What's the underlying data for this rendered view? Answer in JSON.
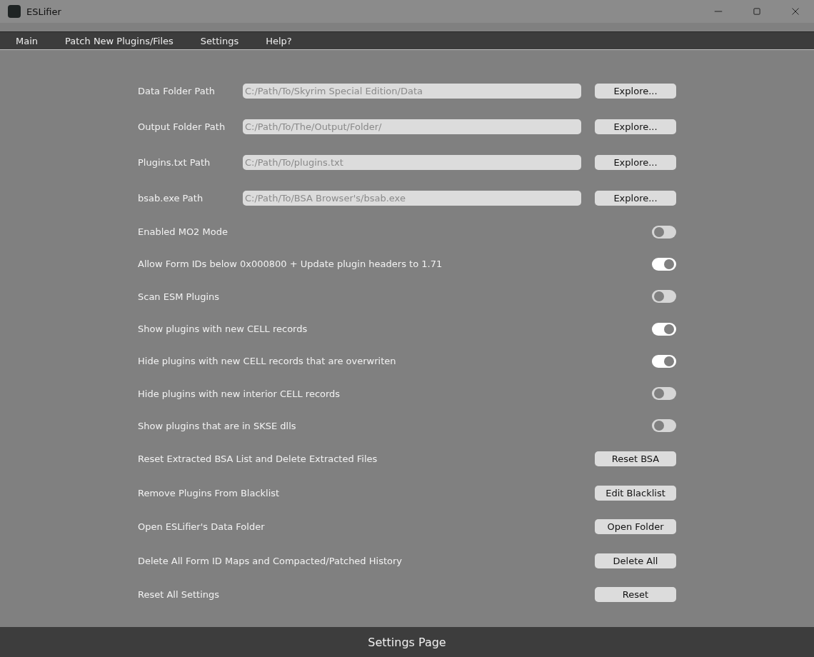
{
  "window": {
    "title": "ESLifier"
  },
  "menu": [
    {
      "label": "Main"
    },
    {
      "label": "Patch New Plugins/Files"
    },
    {
      "label": "Settings"
    },
    {
      "label": "Help?"
    }
  ],
  "settings": [
    {
      "kind": "path",
      "label": "Data Folder Path",
      "placeholder": "C:/Path/To/Skyrim Special Edition/Data",
      "button": "Explore..."
    },
    {
      "kind": "path",
      "label": "Output Folder Path",
      "placeholder": "C:/Path/To/The/Output/Folder/",
      "button": "Explore..."
    },
    {
      "kind": "path",
      "label": "Plugins.txt Path",
      "placeholder": "C:/Path/To/plugins.txt",
      "button": "Explore..."
    },
    {
      "kind": "path",
      "label": "bsab.exe Path",
      "placeholder": "C:/Path/To/BSA Browser's/bsab.exe",
      "button": "Explore..."
    },
    {
      "kind": "toggle",
      "label": "Enabled MO2 Mode",
      "on": false
    },
    {
      "kind": "toggle",
      "label": "Allow Form IDs below 0x000800 + Update plugin headers to 1.71",
      "on": true
    },
    {
      "kind": "toggle",
      "label": "Scan ESM Plugins",
      "on": false
    },
    {
      "kind": "toggle",
      "label": "Show plugins with new CELL records",
      "on": true
    },
    {
      "kind": "toggle",
      "label": "Hide plugins with new CELL records that are overwriten",
      "on": true
    },
    {
      "kind": "toggle",
      "label": "Hide plugins with new interior CELL records",
      "on": false
    },
    {
      "kind": "toggle",
      "label": "Show plugins that are in SKSE dlls",
      "on": false
    },
    {
      "kind": "action",
      "label": "Reset Extracted BSA List and Delete Extracted Files",
      "button": "Reset BSA"
    },
    {
      "kind": "action",
      "label": "Remove Plugins From Blacklist",
      "button": "Edit Blacklist"
    },
    {
      "kind": "action",
      "label": "Open ESLifier's Data Folder",
      "button": "Open Folder"
    },
    {
      "kind": "action",
      "label": "Delete All Form ID Maps and Compacted/Patched History",
      "button": "Delete All"
    },
    {
      "kind": "action",
      "label": "Reset All Settings",
      "button": "Reset"
    }
  ],
  "status_bar": {
    "text": "Settings Page"
  }
}
